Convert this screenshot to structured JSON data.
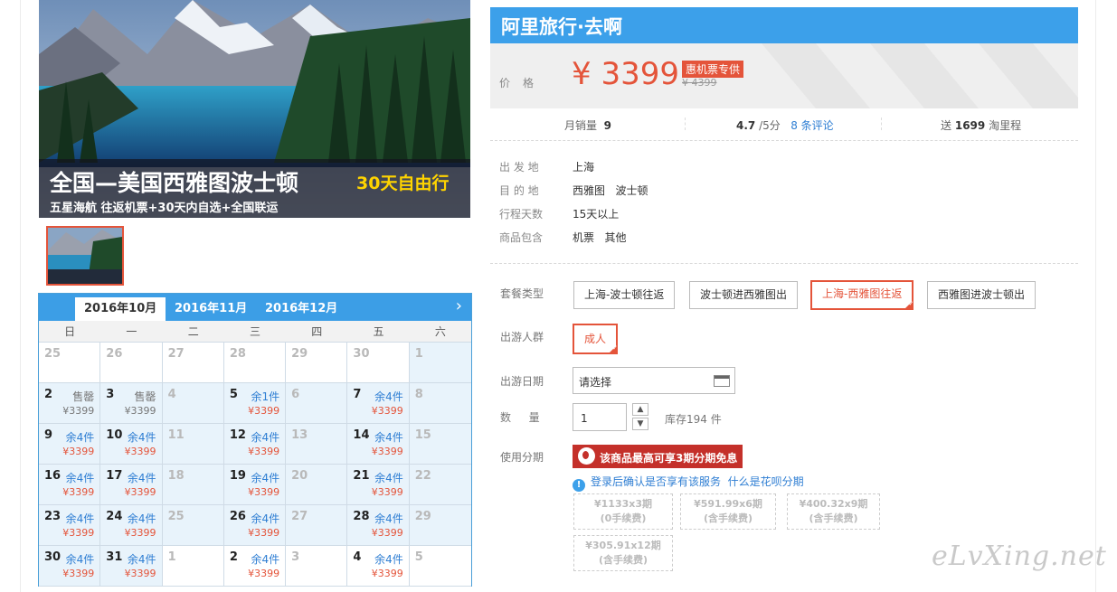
{
  "hero": {
    "title": "全国—美国西雅图波士顿",
    "accent": "30天自由行",
    "subtitle": "五星海航 往返机票+30天内自选+全国联运"
  },
  "calendar": {
    "tabs": [
      "2016年10月",
      "2016年11月",
      "2016年12月"
    ],
    "next_icon": "chevron-right-icon",
    "weekdays": [
      "日",
      "一",
      "二",
      "三",
      "四",
      "五",
      "六"
    ],
    "cells": [
      {
        "day": "25",
        "muted": true
      },
      {
        "day": "26",
        "muted": true
      },
      {
        "day": "27",
        "muted": true
      },
      {
        "day": "28",
        "muted": true
      },
      {
        "day": "29",
        "muted": true
      },
      {
        "day": "30",
        "muted": true
      },
      {
        "day": "1",
        "muted": true,
        "in": true
      },
      {
        "day": "2",
        "status": "售罄",
        "price": "¥3399",
        "sold": true,
        "in": true
      },
      {
        "day": "3",
        "status": "售罄",
        "price": "¥3399",
        "sold": true,
        "in": true
      },
      {
        "day": "4",
        "muted": true,
        "in": true
      },
      {
        "day": "5",
        "status": "余1件",
        "price": "¥3399",
        "in": true
      },
      {
        "day": "6",
        "muted": true,
        "in": true
      },
      {
        "day": "7",
        "status": "余4件",
        "price": "¥3399",
        "in": true
      },
      {
        "day": "8",
        "muted": true,
        "in": true
      },
      {
        "day": "9",
        "status": "余4件",
        "price": "¥3399",
        "in": true
      },
      {
        "day": "10",
        "status": "余4件",
        "price": "¥3399",
        "in": true
      },
      {
        "day": "11",
        "muted": true,
        "in": true
      },
      {
        "day": "12",
        "status": "余4件",
        "price": "¥3399",
        "in": true
      },
      {
        "day": "13",
        "muted": true,
        "in": true
      },
      {
        "day": "14",
        "status": "余4件",
        "price": "¥3399",
        "in": true
      },
      {
        "day": "15",
        "muted": true,
        "in": true
      },
      {
        "day": "16",
        "status": "余4件",
        "price": "¥3399",
        "in": true
      },
      {
        "day": "17",
        "status": "余4件",
        "price": "¥3399",
        "in": true
      },
      {
        "day": "18",
        "muted": true,
        "in": true
      },
      {
        "day": "19",
        "status": "余4件",
        "price": "¥3399",
        "in": true
      },
      {
        "day": "20",
        "muted": true,
        "in": true
      },
      {
        "day": "21",
        "status": "余4件",
        "price": "¥3399",
        "in": true
      },
      {
        "day": "22",
        "muted": true,
        "in": true
      },
      {
        "day": "23",
        "status": "余4件",
        "price": "¥3399",
        "in": true
      },
      {
        "day": "24",
        "status": "余4件",
        "price": "¥3399",
        "in": true
      },
      {
        "day": "25",
        "muted": true,
        "in": true
      },
      {
        "day": "26",
        "status": "余4件",
        "price": "¥3399",
        "in": true
      },
      {
        "day": "27",
        "muted": true,
        "in": true
      },
      {
        "day": "28",
        "status": "余4件",
        "price": "¥3399",
        "in": true
      },
      {
        "day": "29",
        "muted": true,
        "in": true
      },
      {
        "day": "30",
        "status": "余4件",
        "price": "¥3399",
        "in": true
      },
      {
        "day": "31",
        "status": "余4件",
        "price": "¥3399",
        "in": true
      },
      {
        "day": "1",
        "muted": true
      },
      {
        "day": "2",
        "status": "余4件",
        "price": "¥3399"
      },
      {
        "day": "3",
        "muted": true
      },
      {
        "day": "4",
        "status": "余4件",
        "price": "¥3399"
      },
      {
        "day": "5",
        "muted": true
      }
    ]
  },
  "brand": {
    "title": "阿里旅行·去啊"
  },
  "price": {
    "label": "价格",
    "current": "¥ 3399",
    "tag": "惠机票专供",
    "original": "¥ 4399"
  },
  "stats": {
    "sales_label": "月销量",
    "sales_value": "9",
    "rating_value": "4.7",
    "rating_suffix": "/5分",
    "reviews_link": "8 条评论",
    "points_prefix": "送",
    "points_value": "1699",
    "points_suffix": "淘里程"
  },
  "info": [
    {
      "key": "出 发 地",
      "value": "上海"
    },
    {
      "key": "目 的 地",
      "value": "西雅图   波士顿"
    },
    {
      "key": "行程天数",
      "value": "15天以上"
    },
    {
      "key": "商品包含",
      "value": "机票   其他"
    }
  ],
  "options": {
    "package_label": "套餐类型",
    "packages": [
      "上海-波士顿往返",
      "波士顿进西雅图出",
      "上海-西雅图往返",
      "西雅图进波士顿出"
    ],
    "selected_package": 2,
    "crowd_label": "出游人群",
    "crowd": "成人",
    "date_label": "出游日期",
    "date_placeholder": "请选择",
    "qty_label": "数  量",
    "qty_value": "1",
    "qty_up": "▲",
    "qty_down": "▼",
    "stock": "库存194 件",
    "installment_label": "使用分期",
    "installment_button": "该商品最高可享3期分期免息",
    "note_icon": "!",
    "note_text": "登录后确认是否享有该服务",
    "note_link": "什么是花呗分期",
    "plans": [
      {
        "line1": "¥1133x3期",
        "line2": "(0手续费)"
      },
      {
        "line1": "¥591.99x6期",
        "line2": "(含手续费)"
      },
      {
        "line1": "¥400.32x9期",
        "line2": "(含手续费)"
      },
      {
        "line1": "¥305.91x12期",
        "line2": "(含手续费)"
      }
    ]
  },
  "watermark": "eLvXing.net"
}
